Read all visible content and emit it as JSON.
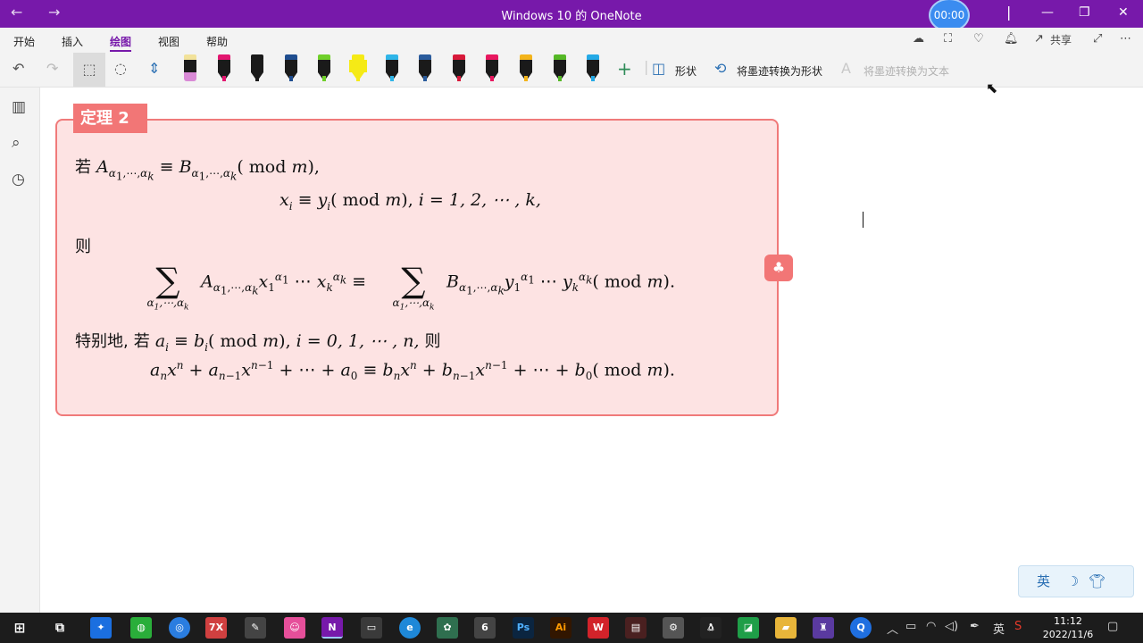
{
  "window": {
    "title": "Windows 10 的 OneNote",
    "timer": "00:00",
    "back_icon": "←",
    "forward_icon": "→"
  },
  "menu": {
    "items": [
      "开始",
      "插入",
      "绘图",
      "视图",
      "帮助"
    ],
    "active": "绘图",
    "share_label": "共享"
  },
  "toolbar": {
    "shapes_label": "形状",
    "ink_to_shape_label": "将墨迹转换为形状",
    "ink_to_text_label": "将墨迹转换为文本",
    "pens": [
      {
        "cap": "#f2e29a",
        "tip": "#d98ad6",
        "kind": "marker"
      },
      {
        "cap": "#e2166f",
        "tip": "#e2166f",
        "kind": "pen"
      },
      {
        "cap": "#1a1a1a",
        "tip": "#1a1a1a",
        "kind": "pen"
      },
      {
        "cap": "#1f4d8f",
        "tip": "#1f4d8f",
        "kind": "pen"
      },
      {
        "cap": "#6fcf2a",
        "tip": "#6fcf2a",
        "kind": "pen"
      },
      {
        "cap": "#f5ea16",
        "tip": "#f5ea16",
        "kind": "highlighter"
      },
      {
        "cap": "#2fb5e8",
        "tip": "#2fb5e8",
        "kind": "pen"
      },
      {
        "cap": "#2a5b9c",
        "tip": "#2a5b9c",
        "kind": "pen"
      },
      {
        "cap": "#d8193a",
        "tip": "#d8193a",
        "kind": "pen"
      },
      {
        "cap": "#e8175f",
        "tip": "#e8175f",
        "kind": "pen"
      },
      {
        "cap": "#f3b41b",
        "tip": "#f3b41b",
        "kind": "pen"
      },
      {
        "cap": "#55b826",
        "tip": "#55b826",
        "kind": "pen"
      },
      {
        "cap": "#24a9e6",
        "tip": "#24a9e6",
        "kind": "pen"
      }
    ]
  },
  "note": {
    "tag": "定理 2",
    "word_if": "若",
    "word_then": "则",
    "word_special": "特别地,",
    "word_if2": "若",
    "word_then2": "则",
    "seq_i_range": "i = 1, 2, ⋯ , k,",
    "seq_i_range2": "i = 0, 1, ⋯ , n,"
  },
  "colors": {
    "title_bar": "#7719aa",
    "theorem_bg": "#fde3e3",
    "theorem_border": "#f07a7a",
    "tag_bg": "#f27676"
  },
  "ime": {
    "label": "英"
  },
  "taskbar": {
    "time": "11:12",
    "date": "2022/11/6",
    "lang": "英"
  }
}
